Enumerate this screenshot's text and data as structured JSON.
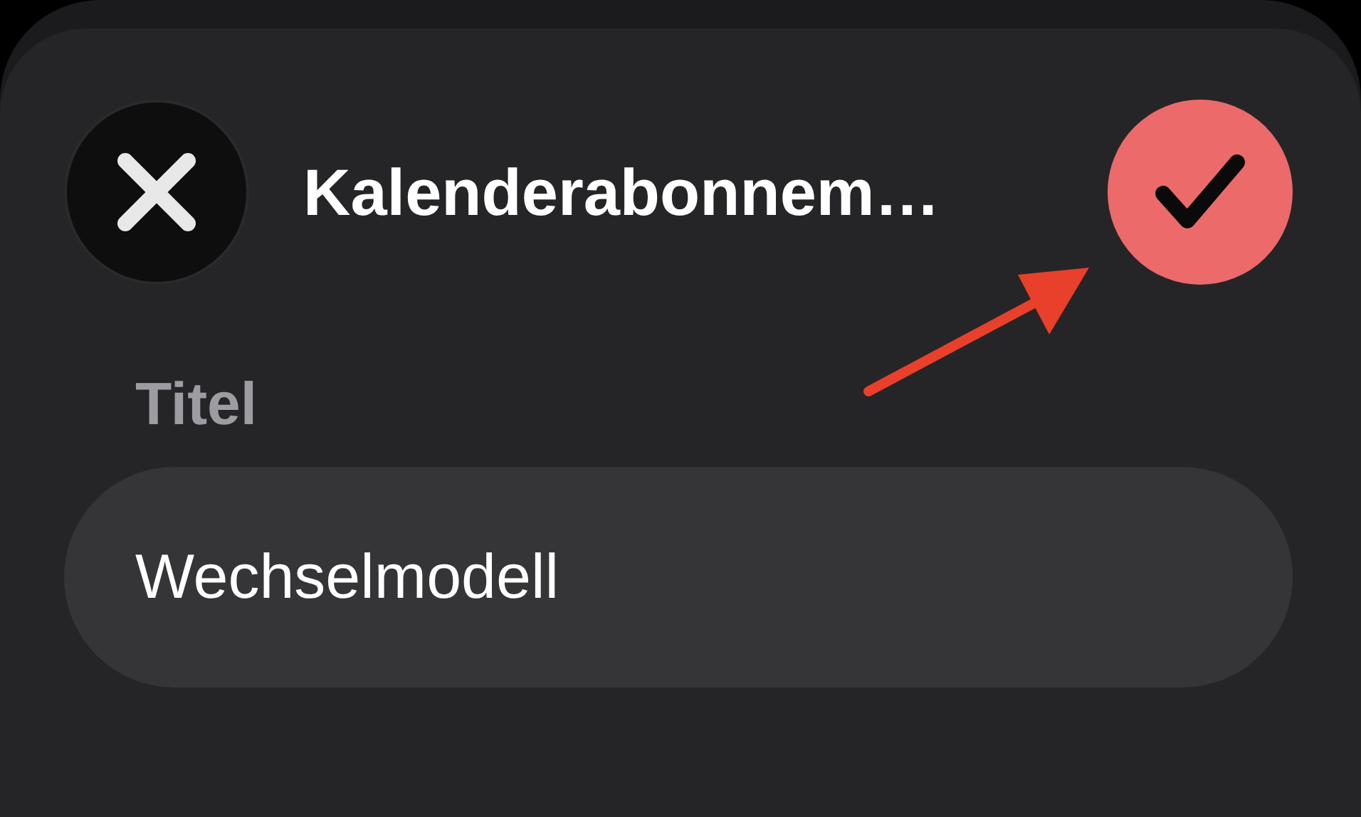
{
  "header": {
    "title": "Kalenderabonnem…"
  },
  "form": {
    "label": "Titel",
    "value": "Wechselmodell"
  },
  "annotation": {
    "kind": "arrow"
  }
}
